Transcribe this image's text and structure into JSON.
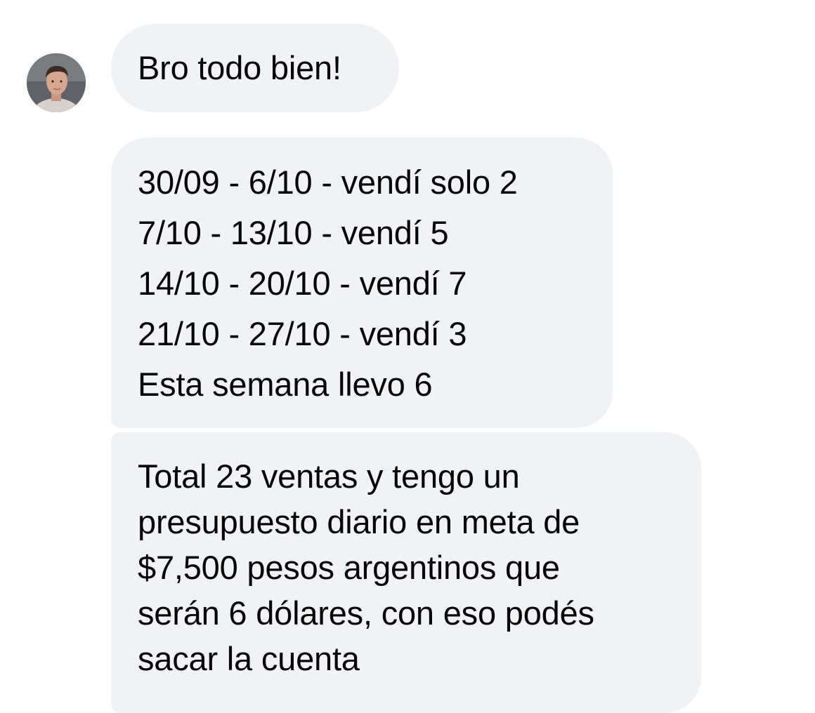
{
  "conversation": {
    "messages": [
      {
        "lines": [
          "Bro todo bien!"
        ]
      },
      {
        "lines": [
          "30/09 - 6/10 - vendí solo 2",
          "7/10 - 13/10 - vendí 5",
          "14/10 - 20/10 - vendí 7",
          "21/10 - 27/10 - vendí 3",
          "Esta semana llevo 6"
        ]
      },
      {
        "lines": [
          "Total 23 ventas y tengo un",
          "presupuesto diario en meta de",
          "$7,500 pesos argentinos que",
          "serán 6 dólares, con eso podés",
          "sacar la cuenta"
        ]
      }
    ]
  },
  "colors": {
    "bubble_background": "#f0f2f5",
    "text": "#050505",
    "page_background": "#ffffff"
  },
  "icons": {
    "sender_avatar": "avatar"
  }
}
